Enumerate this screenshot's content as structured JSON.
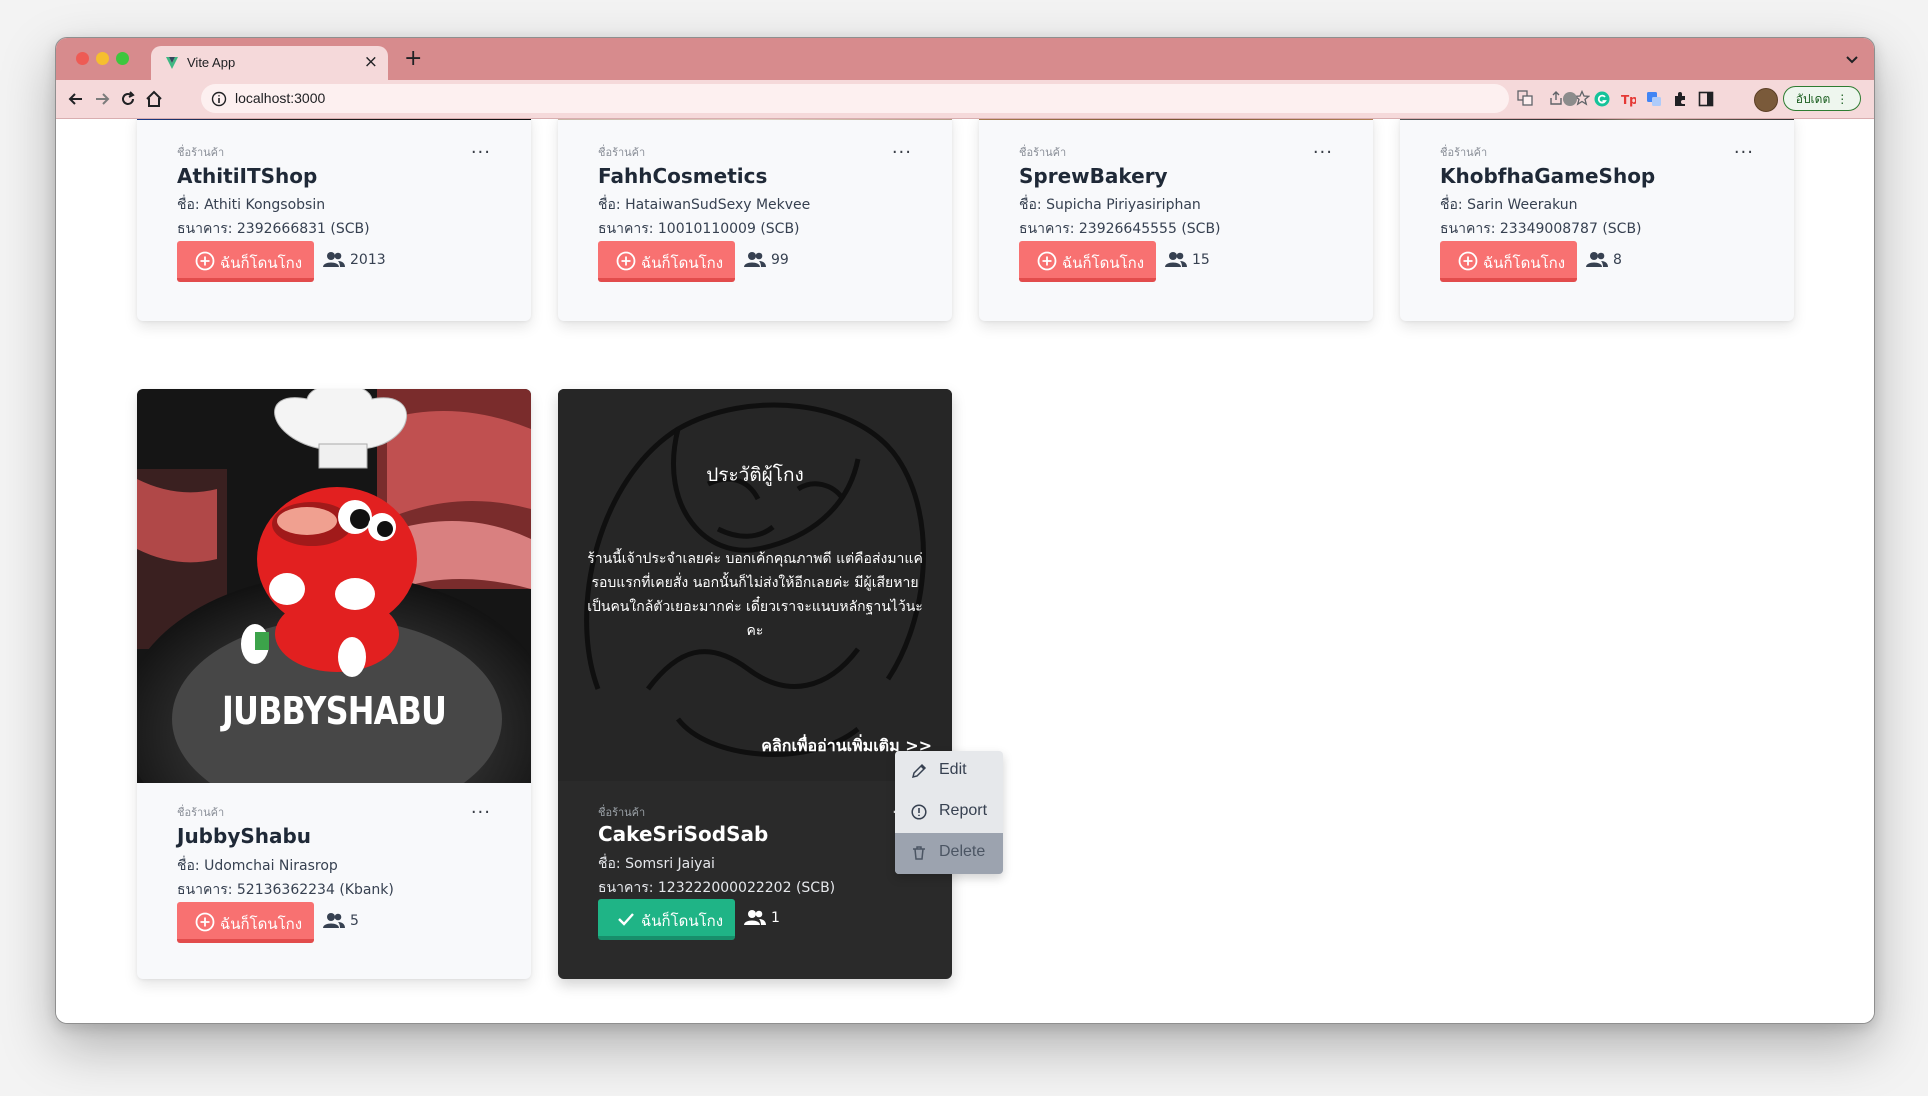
{
  "browser": {
    "tab_title": "Vite App",
    "tab_close": "×",
    "new_tab": "+",
    "address": "localhost:3000",
    "update_button": "อัปเดต"
  },
  "shop_label": "ชื่อร้านค้า",
  "more_menu": "...",
  "report_label": "ฉันก็โดนโกง",
  "cards": [
    {
      "shop": "AthitiITShop",
      "owner": "ชื่อ: Athiti Kongsobsin",
      "bank": "ธนาคาร: 2392666831 (SCB)",
      "count": "2013"
    },
    {
      "shop": "FahhCosmetics",
      "owner": "ชื่อ: HataiwanSudSexy Mekvee",
      "bank": "ธนาคาร: 10010110009 (SCB)",
      "count": "99"
    },
    {
      "shop": "SprewBakery",
      "owner": "ชื่อ: Supicha Piriyasiriphan",
      "bank": "ธนาคาร: 23926645555 (SCB)",
      "count": "15"
    },
    {
      "shop": "KhobfhaGameShop",
      "owner": "ชื่อ: Sarin Weerakun",
      "bank": "ธนาคาร: 23349008787 (SCB)",
      "count": "8"
    },
    {
      "shop": "JubbyShabu",
      "owner": "ชื่อ: Udomchai Nirasrop",
      "bank": "ธนาคาร: 52136362234 (Kbank)",
      "count": "5",
      "image_text": "JUBBYSHABU"
    },
    {
      "shop": "CakeSriSodSab",
      "owner": "ชื่อ: Somsri Jaiyai",
      "bank": "ธนาคาร: 123222000022202 (SCB)",
      "count": "1",
      "reported": true
    }
  ],
  "history": {
    "title": "ประวัติผู้โกง",
    "text": "ร้านนี้เจ้าประจำเลยค่ะ บอกเค้กคุณภาพดี แต่คือส่งมาแค่รอบแรกที่เคยสั่ง นอกนั้นก็ไม่ส่งให้อีกเลยค่ะ มีผู้เสียหายเป็นคนใกล้ตัวเยอะมากค่ะ เดี๋ยวเราจะแนบหลักฐานไว้นะคะ",
    "more": "คลิกเพื่ออ่านเพิ่มเติม >>"
  },
  "menu": {
    "items": [
      {
        "label": "Edit",
        "icon": "pencil-icon"
      },
      {
        "label": "Report",
        "icon": "alert-circle-icon"
      },
      {
        "label": "Delete",
        "icon": "trash-icon"
      }
    ]
  },
  "colors": {
    "report_button": "#f87171",
    "reported_button": "#1fb486",
    "titlebar": "#d78b8d"
  }
}
